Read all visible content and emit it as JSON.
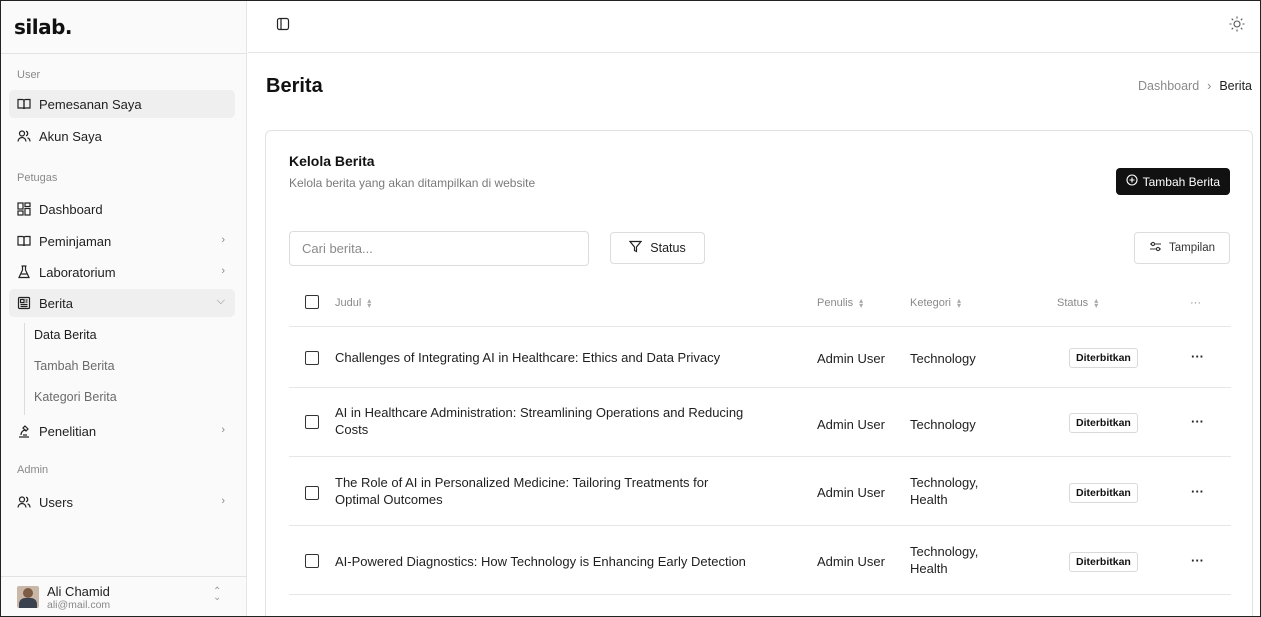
{
  "sidebar": {
    "logo": "silab.",
    "sections": {
      "user": "User",
      "petugas": "Petugas",
      "admin": "Admin"
    },
    "items": {
      "pemesanan": "Pemesanan Saya",
      "akun": "Akun Saya",
      "dashboard": "Dashboard",
      "peminjaman": "Peminjaman",
      "laboratorium": "Laboratorium",
      "berita": "Berita",
      "penelitian": "Penelitian",
      "users": "Users"
    },
    "berita_sub": {
      "data": "Data Berita",
      "tambah": "Tambah Berita",
      "kategori": "Kategori Berita"
    },
    "user": {
      "name": "Ali Chamid",
      "email": "ali@mail.com"
    }
  },
  "header": {
    "title": "Berita",
    "breadcrumb": [
      "Dashboard",
      "Berita"
    ],
    "separator": "›"
  },
  "card": {
    "title": "Kelola Berita",
    "subtitle": "Kelola berita yang akan ditampilkan di website",
    "add_button": "Tambah Berita",
    "search_placeholder": "Cari berita...",
    "status_filter": "Status",
    "view_button": "Tampilan"
  },
  "table": {
    "columns": {
      "judul": "Judul",
      "penulis": "Penulis",
      "kategori": "Ketegori",
      "status": "Status",
      "actions": "···"
    },
    "rows": [
      {
        "title_l1": "Challenges of Integrating AI in Healthcare: Ethics and Data Privacy",
        "title_l2": "",
        "author": "Admin User",
        "cat_l1": "Technology",
        "cat_l2": "",
        "status": "Diterbitkan"
      },
      {
        "title_l1": "AI in Healthcare Administration: Streamlining Operations and Reducing",
        "title_l2": "Costs",
        "author": "Admin User",
        "cat_l1": "Technology",
        "cat_l2": "",
        "status": "Diterbitkan"
      },
      {
        "title_l1": "The Role of AI in Personalized Medicine: Tailoring Treatments for",
        "title_l2": "Optimal Outcomes",
        "author": "Admin User",
        "cat_l1": "Technology,",
        "cat_l2": "Health",
        "status": "Diterbitkan"
      },
      {
        "title_l1": "AI-Powered Diagnostics: How Technology is Enhancing Early Detection",
        "title_l2": "",
        "author": "Admin User",
        "cat_l1": "Technology,",
        "cat_l2": "Health",
        "status": "Diterbitkan"
      }
    ],
    "more_label": "···"
  }
}
